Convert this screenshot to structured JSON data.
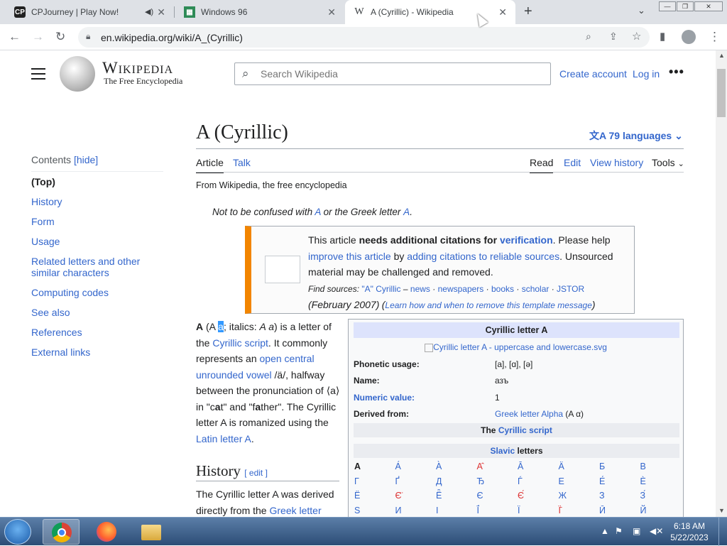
{
  "browser": {
    "tabs": [
      {
        "label": "CPJourney | Play Now!",
        "icon": "cpj-favicon"
      },
      {
        "label": "Windows 96",
        "icon": "win96-favicon"
      },
      {
        "label": "A (Cyrillic) - Wikipedia",
        "icon": "wikipedia-favicon"
      }
    ],
    "url": "en.wikipedia.org/wiki/A_(Cyrillic)"
  },
  "wiki": {
    "wordmark": "Wikipedia",
    "tagline": "The Free Encyclopedia",
    "search_placeholder": "Search Wikipedia",
    "create_account": "Create account",
    "login": "Log in",
    "toc": {
      "title": "Contents",
      "hide": "[hide]",
      "items": [
        "(Top)",
        "History",
        "Form",
        "Usage",
        "Related letters and other similar characters",
        "Computing codes",
        "See also",
        "References",
        "External links"
      ]
    },
    "title": "A (Cyrillic)",
    "languages": "79 languages",
    "tabs": {
      "article": "Article",
      "talk": "Talk",
      "read": "Read",
      "edit": "Edit",
      "history": "View history",
      "tools": "Tools"
    },
    "from": "From Wikipedia, the free encyclopedia",
    "hatnote": {
      "prefix": "Not to be confused with ",
      "link1": "A",
      "mid": " or the Greek letter ",
      "link2": "Α",
      "end": "."
    },
    "ambox": {
      "p1": "This article ",
      "bold1": "needs additional citations for ",
      "link_verification": "verification",
      "p2": ". Please help ",
      "link_improve": "improve this article",
      "p3": " by ",
      "link_adding": "adding citations to reliable sources",
      "p4": ". Unsourced material may be challenged and removed.",
      "find": "Find sources: ",
      "q": "\"A\" Cyrillic",
      "dash": " – ",
      "news": "news",
      "newspapers": "newspapers",
      "books": "books",
      "scholar": "scholar",
      "jstor": "JSTOR",
      "date": " (February 2007)",
      "learn": "Learn how and when to remove this template message"
    },
    "lead": {
      "b": "A",
      "p1": " (A ",
      "sel": "a",
      "p2": "; italics: ",
      "it": "A a",
      "p3": ") is a letter of the ",
      "l1": "Cyrillic script",
      "p4": ". It commonly represents an ",
      "l2": "open central unrounded vowel",
      "p5": " /ä/, halfway between the pronunciation of ⟨a⟩ in \"c",
      "b2": "a",
      "p6": "t\" and \"f",
      "b3": "a",
      "p7": "ther\". The Cyrillic letter A is romanized using the ",
      "l3": "Latin letter A",
      "p8": "."
    },
    "history_heading": "History",
    "edit_link": "[ edit ]",
    "history_text": {
      "p1": "The Cyrillic letter A was derived directly from the ",
      "l1": "Greek letter"
    },
    "infobox": {
      "title": "Cyrillic letter A",
      "image_alt": "Cyrillic letter A - uppercase and lowercase.svg",
      "rows": [
        {
          "k": "Phonetic usage:",
          "v": "[a], [ɑ], [ə]"
        },
        {
          "k": "Name:",
          "v": "азъ"
        },
        {
          "k": "Numeric value:",
          "v": "1"
        },
        {
          "k": "Derived from:",
          "v_link": "Greek letter Alpha",
          "v_rest": " (Α α)"
        }
      ],
      "band1_pre": "The ",
      "band1_link": "Cyrillic script",
      "band2_link": "Slavic",
      "band2_rest": " letters",
      "letters": [
        [
          "А",
          "А́",
          "А̀",
          "А̂",
          "А̄",
          "Ӓ",
          "Б",
          "В"
        ],
        [
          "Г",
          "Ґ",
          "Д",
          "Ђ",
          "Ѓ",
          "Е",
          "Е́",
          "Ѐ"
        ],
        [
          "Ё",
          "Є̈",
          "Ё̄",
          "Є",
          "Є́",
          "Ж",
          "З",
          "З́"
        ],
        [
          "Ѕ",
          "И",
          "І",
          "Ї́",
          "Ї",
          "Ї̄",
          "Ӣ",
          "Й"
        ]
      ]
    }
  },
  "taskbar": {
    "time": "6:18 AM",
    "date": "5/22/2023"
  }
}
